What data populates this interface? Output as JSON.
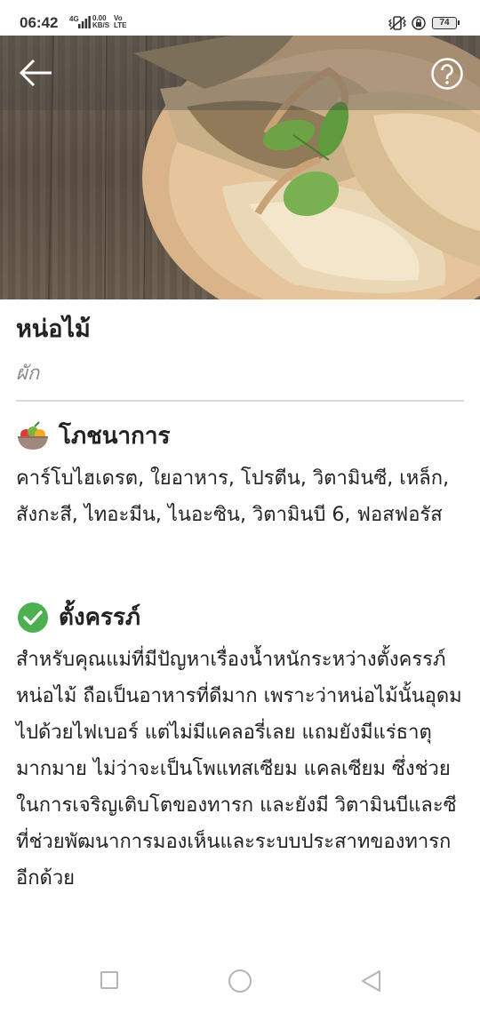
{
  "status_bar": {
    "time": "06:42",
    "network": "4G",
    "speed_value": "0.00",
    "speed_unit": "KB/S",
    "volte_top": "Vo",
    "volte_bottom": "LTE",
    "battery": "74"
  },
  "app_bar": {
    "back_icon": "arrow-left-icon",
    "help_icon": "question-circle-icon"
  },
  "food": {
    "name": "หน่อไม้",
    "category": "ผัก"
  },
  "nutrition": {
    "heading": "โภชนาการ",
    "icon": "food-bowl-icon",
    "text": "คาร์โบไฮเดรต, ใยอาหาร, โปรตีน, วิตามินซี, เหล็ก, สังกะสี, ไทอะมีน, ไนอะซิน, วิตามินบี 6, ฟอสฟอรัส"
  },
  "pregnancy": {
    "heading": "ตั้งครรภ์",
    "icon": "check-circle-icon",
    "status_color": "#4caf50",
    "text": "สำหรับคุณแม่ที่มีปัญหาเรื่องน้ำหนักระหว่างตั้งครรภ์ หน่อไม้ ถือเป็นอาหารที่ดีมาก เพราะว่าหน่อไม้นั้นอุดมไปด้วยไฟเบอร์ แต่ไม่มีแคลอรี่เลย แถมยังมีแร่ธาตุมากมาย ไม่ว่าจะเป็นโพแทสเซียม แคลเซียม ซึ่งช่วยในการเจริญเติบโตของทารก และยังมี วิตามินบีและซี ที่ช่วยพัฒนาการมองเห็นและระบบประสาทของทารกอีกด้วย"
  },
  "nav_bar": {
    "recents_icon": "square-icon",
    "home_icon": "circle-icon",
    "back_icon": "triangle-back-icon"
  }
}
